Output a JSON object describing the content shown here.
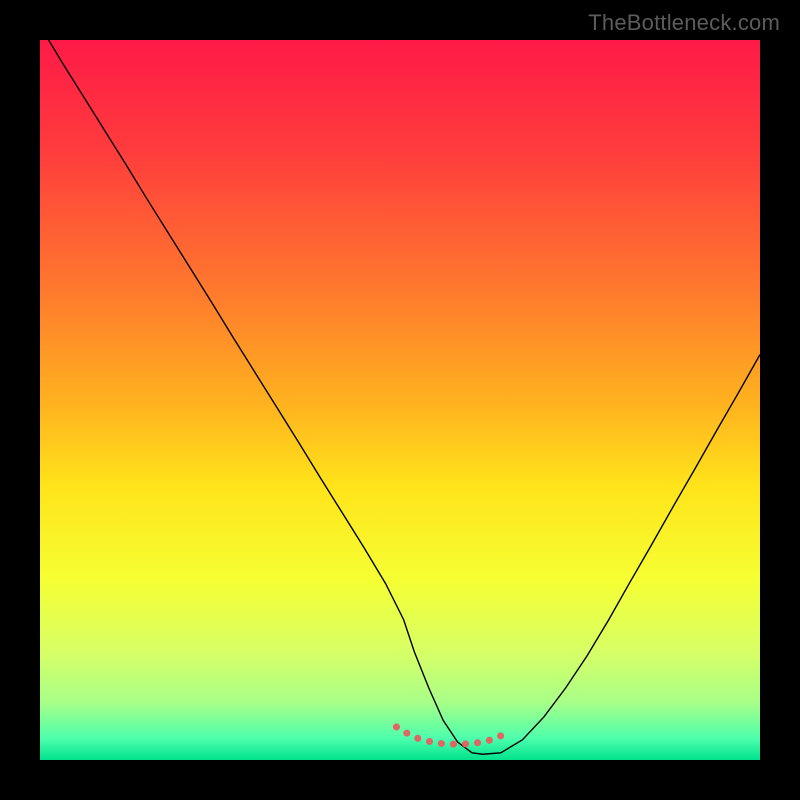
{
  "watermark": "TheBottleneck.com",
  "chart_data": {
    "type": "line",
    "title": "",
    "xlabel": "",
    "ylabel": "",
    "xlim": [
      0,
      100
    ],
    "ylim": [
      0,
      100
    ],
    "grid": false,
    "legend": false,
    "background_gradient_stops": [
      {
        "offset": 0.0,
        "color": "#ff1a47"
      },
      {
        "offset": 0.15,
        "color": "#ff3b3d"
      },
      {
        "offset": 0.35,
        "color": "#ff7a2d"
      },
      {
        "offset": 0.5,
        "color": "#ffb01f"
      },
      {
        "offset": 0.62,
        "color": "#ffe41a"
      },
      {
        "offset": 0.75,
        "color": "#f5ff33"
      },
      {
        "offset": 0.85,
        "color": "#d7ff66"
      },
      {
        "offset": 0.92,
        "color": "#a8ff88"
      },
      {
        "offset": 0.97,
        "color": "#4dffac"
      },
      {
        "offset": 1.0,
        "color": "#00e28e"
      }
    ],
    "series": [
      {
        "name": "bottleneck-curve",
        "color": "#000000",
        "stroke_width": 1.4,
        "x": [
          0,
          3,
          6,
          9,
          12,
          15,
          18,
          21,
          24,
          27,
          30,
          33,
          36,
          39,
          42,
          45,
          48,
          50.5,
          52,
          54,
          56,
          58,
          60,
          61.5,
          64,
          67,
          70,
          73,
          76,
          79,
          82,
          85,
          88,
          91,
          94,
          97,
          100
        ],
        "y": [
          102,
          97,
          92.2,
          87.4,
          82.6,
          77.7,
          72.9,
          68.1,
          63.3,
          58.4,
          53.6,
          48.8,
          44.0,
          39.1,
          34.3,
          29.5,
          24.5,
          19.5,
          15.0,
          10.0,
          5.5,
          2.5,
          1.0,
          0.8,
          1.0,
          2.8,
          6.0,
          10.0,
          14.5,
          19.5,
          24.8,
          30.0,
          35.3,
          40.5,
          45.8,
          51.0,
          56.3
        ]
      },
      {
        "name": "valley-marker",
        "color": "#e06666",
        "stroke_width": 7,
        "linecap": "round",
        "dash": "0.1 12",
        "x": [
          49.5,
          51.0,
          52.5,
          54.0,
          55.5,
          57.0,
          58.5,
          60.0,
          61.5,
          63.0,
          64.3,
          65.3
        ],
        "y": [
          4.6,
          3.7,
          3.0,
          2.6,
          2.3,
          2.2,
          2.2,
          2.3,
          2.5,
          2.9,
          3.5,
          4.3
        ]
      }
    ]
  }
}
